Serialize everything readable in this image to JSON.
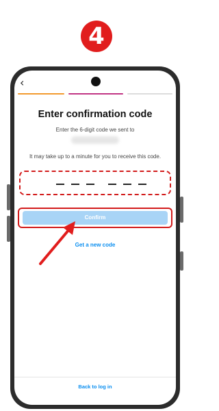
{
  "step_number": "4",
  "screen": {
    "title": "Enter confirmation code",
    "subtitle": "Enter the 6-digit code we sent to",
    "notice": "It may take up to a minute for you to receive this code.",
    "confirm_label": "Confirm",
    "new_code_label": "Get a new code",
    "back_to_login_label": "Back to log in"
  },
  "colors": {
    "highlight": "#d21a1a",
    "link": "#0a8ef0",
    "confirm_disabled": "#a8d4f6",
    "progress_done": "#f29a2e",
    "progress_active": "#c13584"
  }
}
